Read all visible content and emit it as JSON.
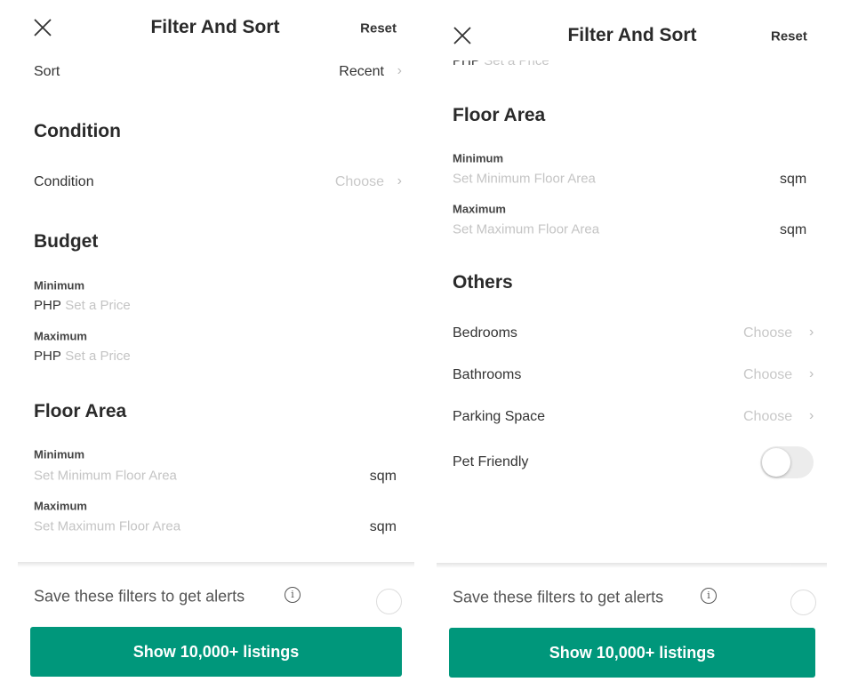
{
  "header": {
    "title": "Filter And Sort",
    "reset": "Reset"
  },
  "left": {
    "sort": {
      "label": "Sort",
      "value": "Recent"
    },
    "condition": {
      "heading": "Condition",
      "label": "Condition",
      "value": "Choose"
    },
    "budget": {
      "heading": "Budget",
      "min_label": "Minimum",
      "max_label": "Maximum",
      "currency": "PHP",
      "placeholder": "Set a Price"
    },
    "floor": {
      "heading": "Floor Area",
      "min_label": "Minimum",
      "min_placeholder": "Set Minimum Floor Area",
      "max_label": "Maximum",
      "max_placeholder": "Set Maximum Floor Area",
      "unit": "sqm"
    }
  },
  "right": {
    "budget_partial": {
      "currency": "PHP",
      "placeholder": "Set a Price"
    },
    "floor": {
      "heading": "Floor Area",
      "min_label": "Minimum",
      "min_placeholder": "Set Minimum Floor Area",
      "max_label": "Maximum",
      "max_placeholder": "Set Maximum Floor Area",
      "unit": "sqm"
    },
    "others": {
      "heading": "Others",
      "items": [
        {
          "label": "Bedrooms",
          "value": "Choose"
        },
        {
          "label": "Bathrooms",
          "value": "Choose"
        },
        {
          "label": "Parking Space",
          "value": "Choose"
        }
      ],
      "pet_label": "Pet Friendly",
      "pet_on": false
    }
  },
  "footer": {
    "save_text": "Save these filters to get alerts",
    "info": "i",
    "button": "Show 10,000+ listings"
  },
  "colors": {
    "accent": "#00977b"
  }
}
